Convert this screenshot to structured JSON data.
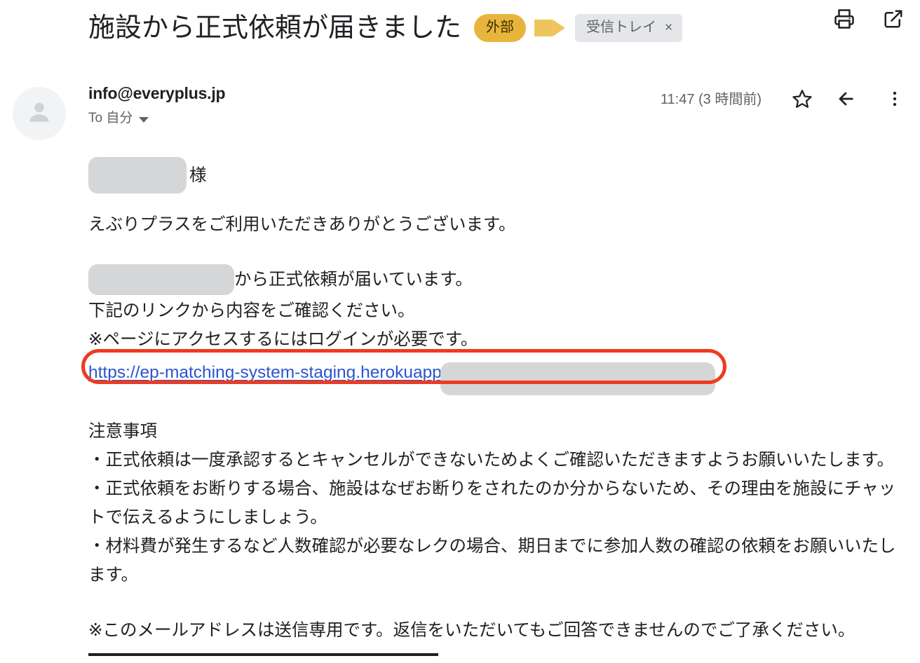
{
  "header": {
    "subject": "施設から正式依頼が届きました",
    "external_badge": "外部",
    "label_chip": "受信トレイ",
    "label_chip_close": "×",
    "print_icon": "print-icon",
    "open_in_new_icon": "open-in-new-icon"
  },
  "message": {
    "sender_email": "info@everyplus.jp",
    "recipient_line": "To 自分",
    "timestamp": "11:47 (3 時間前)",
    "star_icon": "star-outline-icon",
    "reply_icon": "reply-arrow-icon",
    "more_icon": "more-vertical-icon",
    "avatar_icon": "person-avatar-icon"
  },
  "body": {
    "greeting_suffix": "様",
    "thanks": "えぶりプラスをご利用いただきありがとうございます。",
    "request_notice_suffix": "から正式依頼が届いています。",
    "check_link_line": "下記のリンクから内容をご確認ください。",
    "login_required_line": "※ページにアクセスするにはログインが必要です。",
    "link_text": "https://ep-matching-system-staging.herokuapp",
    "notes_title": "注意事項",
    "note_1": "・正式依頼は一度承認するとキャンセルができないためよくご確認いただきますようお願いいたします。",
    "note_2": "・正式依頼をお断りする場合、施設はなぜお断りをされたのか分からないため、その理由を施設にチャットで伝えるようにしましょう。",
    "note_3": "・材料費が発生するなど人数確認が必要なレクの場合、期日までに参加人数の確認の依頼をお願いいたします。",
    "footer_notice": "※このメールアドレスは送信専用です。返信をいただいてもご回答できませんのでご了承ください。"
  },
  "colors": {
    "external_badge_bg": "#e8b53c",
    "label_chip_bg": "#e4e6e9",
    "link": "#2b55d0",
    "annotation": "#ee3b1f",
    "redaction": "#d4d6d8"
  }
}
